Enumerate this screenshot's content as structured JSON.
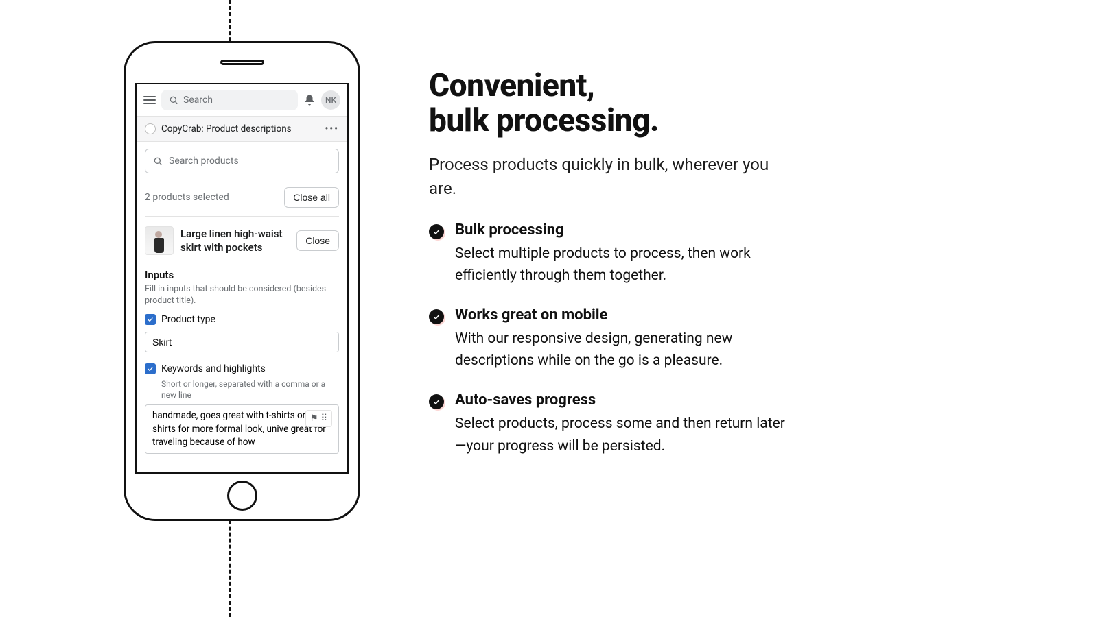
{
  "topbar": {
    "search_placeholder": "Search",
    "avatar_initials": "NK"
  },
  "apprail": {
    "title": "CopyCrab: Product descriptions"
  },
  "sheet": {
    "search_placeholder": "Search products",
    "selected_text": "2 products selected",
    "close_all": "Close all",
    "product": {
      "title": "Large linen high-waist skirt with pockets",
      "close": "Close"
    },
    "inputs": {
      "heading": "Inputs",
      "sub": "Fill in inputs that should be considered (besides product title).",
      "product_type_label": "Product type",
      "product_type_value": "Skirt",
      "keywords_label": "Keywords and highlights",
      "keywords_hint": "Short or longer, separated with a comma or a new line",
      "keywords_value": "handmade, goes great with t-shirts or even shirts for more formal look, unive great for traveling because of how"
    }
  },
  "marketing": {
    "headline_l1": "Convenient,",
    "headline_l2": "bulk processing.",
    "lede": "Process products quickly in bulk, wherever you are.",
    "features": [
      {
        "title": "Bulk processing",
        "body": "Select multiple products to process, then work efficiently through them together."
      },
      {
        "title": "Works great on mobile",
        "body": "With our responsive design, generating new descriptions while on the go is a pleasure."
      },
      {
        "title": "Auto-saves progress",
        "body": "Select products, process some and then return later—your progress will be persisted."
      }
    ]
  }
}
